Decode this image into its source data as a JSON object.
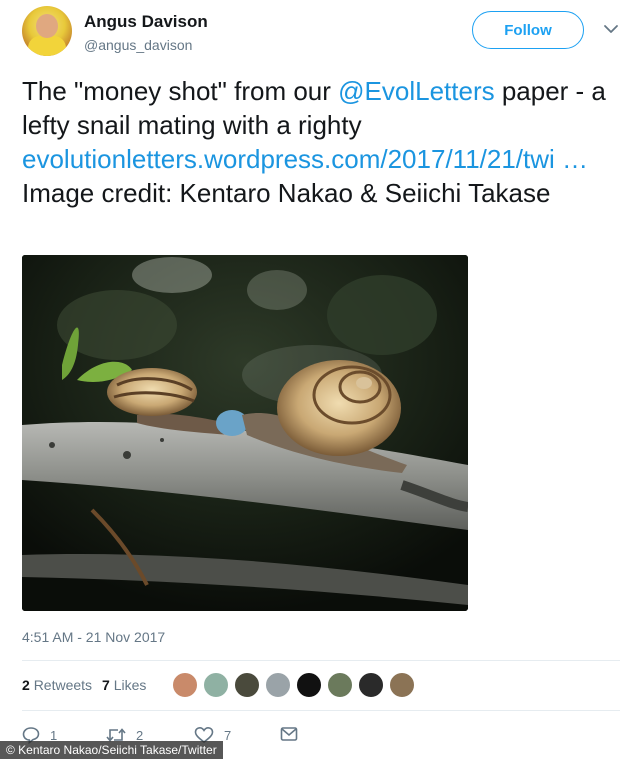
{
  "author": {
    "display_name": "Angus Davison",
    "handle": "@angus_davison"
  },
  "follow_label": "Follow",
  "tweet": {
    "text_part1": "The \"money shot\" from our ",
    "mention": "@EvolLetters",
    "text_part2": " paper - a lefty snail mating with a righty ",
    "url_text": "evolutionletters.wordpress.com/2017/11/21/twi …",
    "text_part3": " Image credit: Kentaro Nakao & Seiichi Takase"
  },
  "photo": {
    "icon": "snail-photo"
  },
  "timestamp": "4:51 AM - 21 Nov 2017",
  "stats": {
    "retweets_count": "2",
    "retweets_label": "Retweets",
    "likes_count": "7",
    "likes_label": "Likes"
  },
  "likers": [
    {
      "color": "#c98a6a"
    },
    {
      "color": "#8fb1a3"
    },
    {
      "color": "#4a4a3c"
    },
    {
      "color": "#9aa3a8"
    },
    {
      "color": "#111111"
    },
    {
      "color": "#6b7a5c"
    },
    {
      "color": "#2a2a2a"
    },
    {
      "color": "#8b7355"
    }
  ],
  "actions": {
    "reply_count": "1",
    "retweet_count": "2",
    "like_count": "7"
  },
  "credit": "© Kentaro Nakao/Seiichi Takase/Twitter",
  "colors": {
    "accent": "#1da1f2",
    "link": "#1b95e0",
    "muted": "#657786"
  }
}
